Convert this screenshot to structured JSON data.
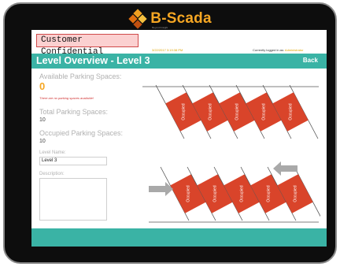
{
  "brand": {
    "name": "B-Scada",
    "tagline": "Beyond Insight"
  },
  "header": {
    "confidential_label": "Customer Confidential",
    "datetime": "3/22/2017 3:19:38 PM",
    "login_prefix": "Currently logged in as:",
    "login_user": "Administrator"
  },
  "titlebar": {
    "title": "Level Overview -  Level 3",
    "back_label": "Back"
  },
  "stats": {
    "available_label": "Available Parking Spaces:",
    "available_value": "0",
    "warning": "There are no parking spaces available!",
    "total_label": "Total Parking Spaces:",
    "total_value": "10",
    "occupied_label": "Occupied Parking Spaces:",
    "occupied_value": "10"
  },
  "form": {
    "level_name_label": "Level Name:",
    "level_name_value": "Level 3",
    "description_label": "Description:",
    "description_value": ""
  },
  "lot": {
    "spaces": [
      {
        "row": "top",
        "status": "Occupied"
      },
      {
        "row": "top",
        "status": "Occupied"
      },
      {
        "row": "top",
        "status": "Occupied"
      },
      {
        "row": "top",
        "status": "Occupied"
      },
      {
        "row": "top",
        "status": "Occupied"
      },
      {
        "row": "bottom",
        "status": "Occupied"
      },
      {
        "row": "bottom",
        "status": "Occupied"
      },
      {
        "row": "bottom",
        "status": "Occupied"
      },
      {
        "row": "bottom",
        "status": "Occupied"
      },
      {
        "row": "bottom",
        "status": "Occupied"
      }
    ],
    "arrows": [
      "left",
      "right"
    ],
    "colors": {
      "occupied": "#d9442a",
      "line": "#555555",
      "arrow": "#a9a9a9"
    }
  },
  "colors": {
    "accent": "#3ab3a5",
    "brand": "#f5a623",
    "confidential_bg": "#fbd0d0",
    "confidential_border": "#d04a4a"
  }
}
